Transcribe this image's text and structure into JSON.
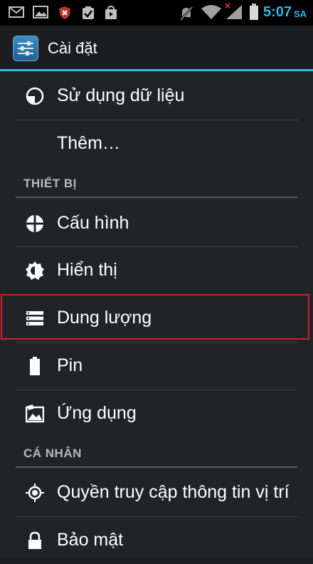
{
  "status_bar": {
    "time": "5:07",
    "ampm": "SA",
    "icons": [
      "gmail-icon",
      "gallery-icon",
      "shield-icon",
      "clipboard-check-icon",
      "store-icon",
      "mute-icon",
      "wifi-icon",
      "signal-icon",
      "battery-icon"
    ]
  },
  "action_bar": {
    "title": "Cài đặt",
    "icon": "settings-sliders-icon"
  },
  "items": {
    "data_usage": "Sử dụng dữ liệu",
    "more": "Thêm…",
    "config": "Cấu hình",
    "display": "Hiển thị",
    "storage": "Dung lượng",
    "battery": "Pin",
    "apps": "Ứng dụng",
    "location": "Quyền truy cập thông tin vị trí",
    "security": "Bảo mật"
  },
  "sections": {
    "device": "THIẾT BỊ",
    "personal": "CÁ NHÂN"
  },
  "colors": {
    "accent": "#33b5e5",
    "highlight": "#d32027",
    "background": "#212427"
  }
}
